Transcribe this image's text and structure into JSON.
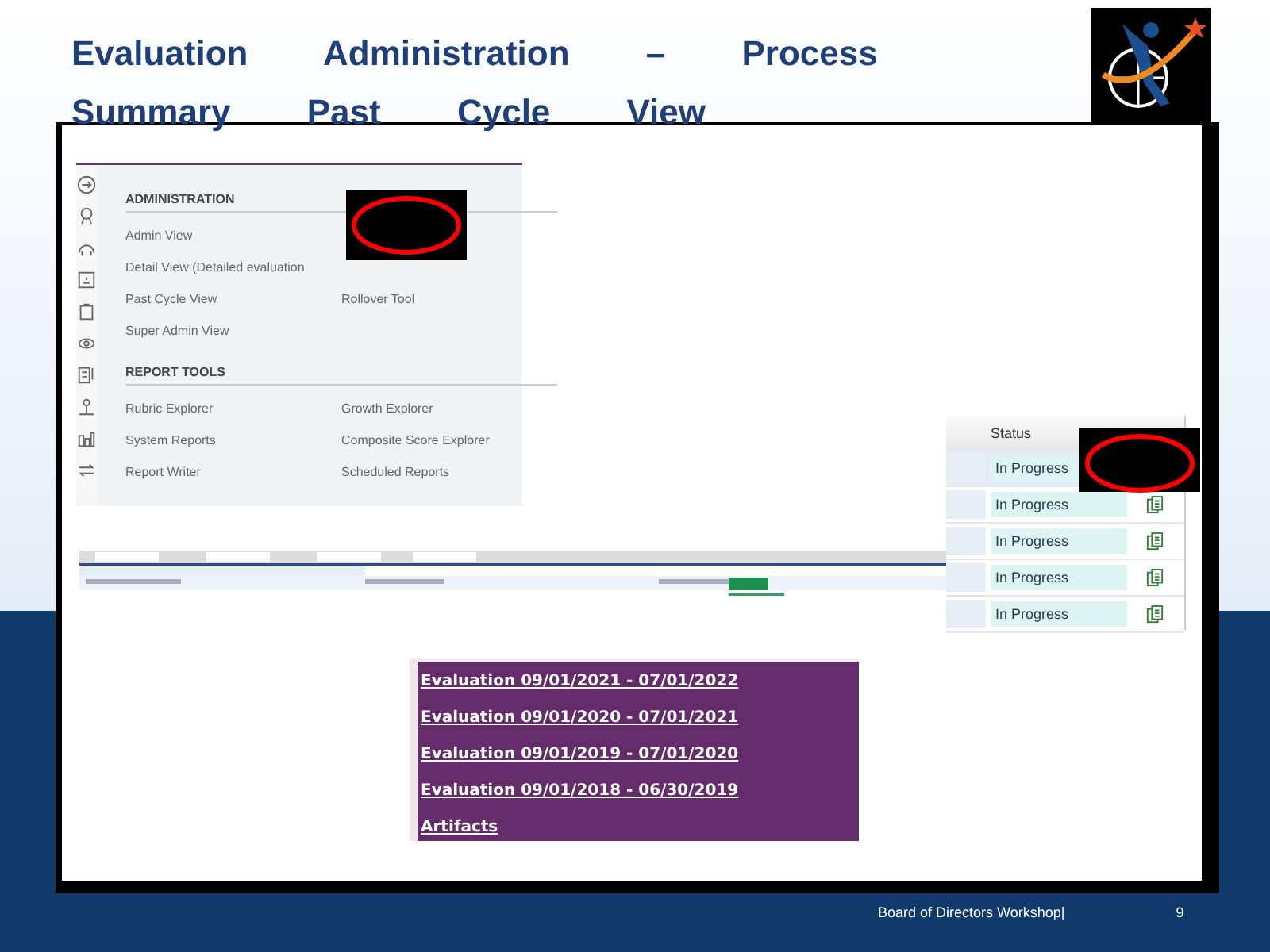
{
  "slide": {
    "title": "Evaluation Administration – Process Summary Past Cycle View"
  },
  "admin_menu": {
    "sections": [
      {
        "heading": "ADMINISTRATION",
        "rows": [
          [
            "Admin View"
          ],
          [
            "Detail View (Detailed evaluation"
          ],
          [
            "Past Cycle View",
            "Rollover Tool"
          ],
          [
            "Super Admin View"
          ]
        ]
      },
      {
        "heading": "REPORT TOOLS",
        "rows": [
          [
            "Rubric Explorer",
            "Growth Explorer"
          ],
          [
            "System Reports",
            "Composite Score Explorer"
          ],
          [
            "Report Writer",
            "Scheduled Reports"
          ]
        ]
      }
    ]
  },
  "status_table": {
    "header": "Status",
    "rows": [
      {
        "status": "In Progress"
      },
      {
        "status": "In Progress"
      },
      {
        "status": "In Progress"
      },
      {
        "status": "In Progress"
      },
      {
        "status": "In Progress"
      }
    ]
  },
  "evaluation_links": [
    "Evaluation 09/01/2021 - 07/01/2022",
    "Evaluation 09/01/2020 - 07/01/2021",
    "Evaluation 09/01/2019 - 07/01/2020",
    "Evaluation 09/01/2018 - 06/30/2019",
    "Artifacts"
  ],
  "footer": {
    "text": "Board of Directors Workshop|",
    "page": "9"
  }
}
